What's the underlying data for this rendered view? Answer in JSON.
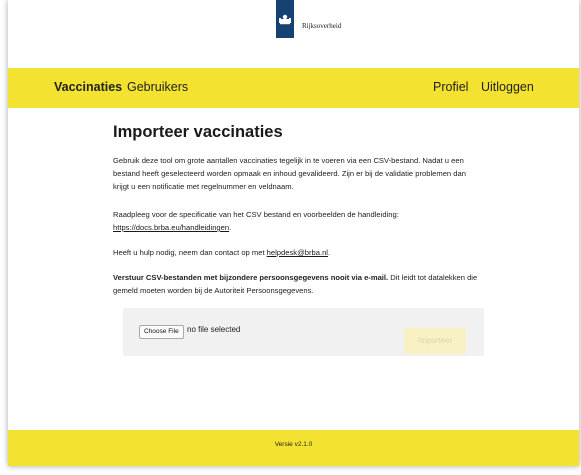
{
  "header": {
    "brand": "Rijksoverheid"
  },
  "nav": {
    "left": [
      {
        "label": "Vaccinaties",
        "active": true
      },
      {
        "label": "Gebruikers",
        "active": false
      }
    ],
    "right": [
      {
        "label": "Profiel"
      },
      {
        "label": "Uitloggen"
      }
    ]
  },
  "main": {
    "title": "Importeer vaccinaties",
    "intro": "Gebruik deze tool om grote aantallen vaccinaties tegelijk in te voeren via een CSV-bestand. Nadat u een bestand heeft geselecteerd worden opmaak en inhoud gevalideerd. Zijn er bij de validatie problemen dan krijgt u een notificatie met regelnummer en veldnaam.",
    "spec_text": "Raadpleeg voor de specificatie van het CSV bestand en voorbeelden de handleiding:",
    "spec_link": "https://docs.brba.eu/handleidingen",
    "spec_end": ".",
    "help_text": "Heeft u hulp nodig, neem dan contact op met ",
    "help_link": "helpdesk@brba.nl",
    "help_end": ".",
    "warning_bold": "Verstuur CSV-bestanden met bijzondere persoonsgegevens nooit via e-mail.",
    "warning_rest": " Dit leidt tot datalekken die gemeld moeten worden bij de Autoriteit Persoonsgegevens."
  },
  "upload": {
    "choose_label": "Choose File",
    "file_status": "no file selected",
    "import_label": "Importeer"
  },
  "footer": {
    "version": "Versie v2.1.0"
  },
  "colors": {
    "accent_yellow": "#f3e230",
    "logo_blue": "#154273",
    "disabled_button": "#f7f1c3"
  },
  "icons": {
    "logo": "coat-of-arms-icon"
  }
}
